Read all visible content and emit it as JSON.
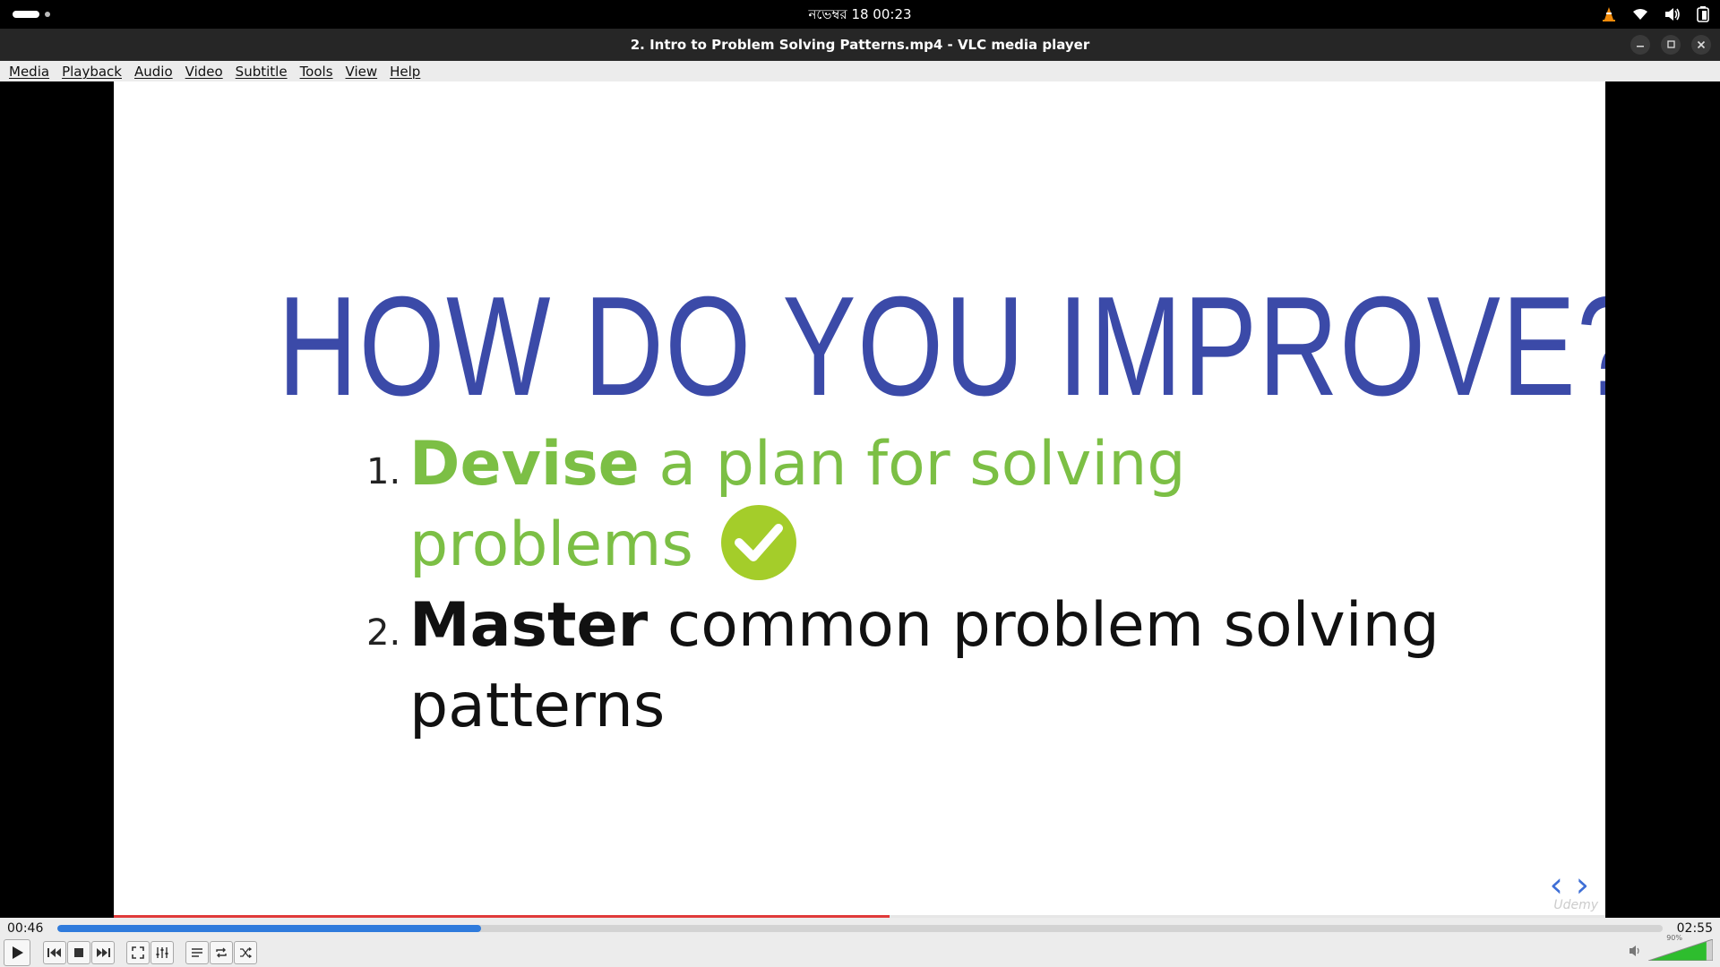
{
  "topbar": {
    "clock": "নভেম্বর 18  00:23"
  },
  "window": {
    "title": "2. Intro to Problem Solving Patterns.mp4 - VLC media player"
  },
  "menu": [
    {
      "label": "Media"
    },
    {
      "label": "Playback"
    },
    {
      "label": "Audio"
    },
    {
      "label": "Video"
    },
    {
      "label": "Subtitle"
    },
    {
      "label": "Tools"
    },
    {
      "label": "View"
    },
    {
      "label": "Help"
    }
  ],
  "slide": {
    "heading": "HOW DO YOU IMPROVE?",
    "item1": {
      "num": "1.",
      "bold": "Devise",
      "rest": " a plan for solving problems"
    },
    "item2": {
      "num": "2.",
      "bold": "Master",
      "rest": " common problem solving patterns"
    },
    "watermark": "Udemy",
    "video_progress": 0.52
  },
  "player": {
    "elapsed": "00:46",
    "total": "02:55",
    "seek_progress": 0.264,
    "volume_label": "90%",
    "volume_level": 0.9
  },
  "colors": {
    "heading": "#3b4aa8",
    "item1": "#7cbf45",
    "check": "#a4cd2a",
    "seek": "#2f7bdc",
    "volume": "#2ebd2e",
    "redline": "#e03a3a"
  }
}
